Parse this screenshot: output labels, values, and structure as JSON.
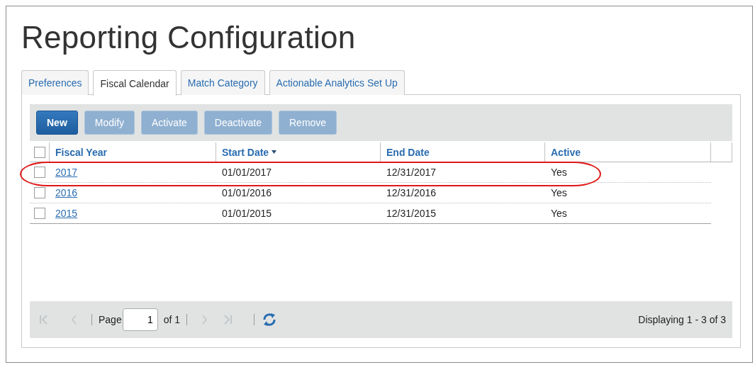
{
  "title": "Reporting Configuration",
  "tabs": [
    {
      "label": "Preferences",
      "selected": false
    },
    {
      "label": "Fiscal Calendar",
      "selected": true
    },
    {
      "label": "Match Category",
      "selected": false
    },
    {
      "label": "Actionable Analytics Set Up",
      "selected": false
    }
  ],
  "toolbar": [
    {
      "label": "New",
      "disabled": false
    },
    {
      "label": "Modify",
      "disabled": true
    },
    {
      "label": "Activate",
      "disabled": true
    },
    {
      "label": "Deactivate",
      "disabled": true
    },
    {
      "label": "Remove",
      "disabled": true
    }
  ],
  "table": {
    "select_all_checked": false,
    "columns": [
      {
        "label": "Fiscal Year",
        "sorted": false
      },
      {
        "label": "Start Date",
        "sorted": true
      },
      {
        "label": "End Date",
        "sorted": false
      },
      {
        "label": "Active",
        "sorted": false
      }
    ],
    "rows": [
      {
        "fiscal_year": "2017",
        "start_date": "01/01/2017",
        "end_date": "12/31/2017",
        "active": "Yes",
        "checked": false,
        "circled": true
      },
      {
        "fiscal_year": "2016",
        "start_date": "01/01/2016",
        "end_date": "12/31/2016",
        "active": "Yes",
        "checked": false,
        "circled": false
      },
      {
        "fiscal_year": "2015",
        "start_date": "01/01/2015",
        "end_date": "12/31/2015",
        "active": "Yes",
        "checked": false,
        "circled": false
      }
    ]
  },
  "pager": {
    "first_disabled": true,
    "prev_disabled": true,
    "page_label": "Page",
    "page": "1",
    "of_label": "of 1",
    "next_disabled": true,
    "last_disabled": true,
    "display": "Displaying 1 - 3 of 3"
  }
}
